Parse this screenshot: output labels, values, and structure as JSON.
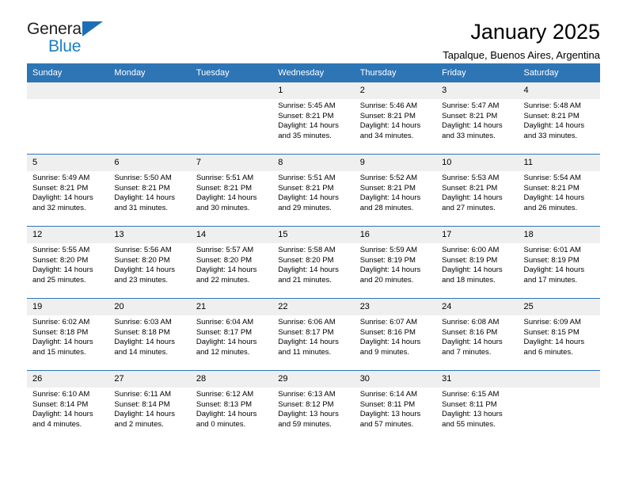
{
  "logo": {
    "top_word": "General",
    "bottom_word": "Blue",
    "triangle_color": "#1c6fb4",
    "blue_color": "#1b7fc4"
  },
  "header": {
    "title": "January 2025",
    "subtitle": "Tapalque, Buenos Aires, Argentina"
  },
  "theme": {
    "header_bg": "#2e75b6",
    "daynum_bg": "#efefef",
    "grid_line": "#2e75b6"
  },
  "calendar": {
    "weekdays": [
      "Sunday",
      "Monday",
      "Tuesday",
      "Wednesday",
      "Thursday",
      "Friday",
      "Saturday"
    ],
    "weeks": [
      [
        {
          "day": "",
          "sunrise": "",
          "sunset": "",
          "daylight_line1": "",
          "daylight_line2": ""
        },
        {
          "day": "",
          "sunrise": "",
          "sunset": "",
          "daylight_line1": "",
          "daylight_line2": ""
        },
        {
          "day": "",
          "sunrise": "",
          "sunset": "",
          "daylight_line1": "",
          "daylight_line2": ""
        },
        {
          "day": "1",
          "sunrise": "Sunrise: 5:45 AM",
          "sunset": "Sunset: 8:21 PM",
          "daylight_line1": "Daylight: 14 hours",
          "daylight_line2": "and 35 minutes."
        },
        {
          "day": "2",
          "sunrise": "Sunrise: 5:46 AM",
          "sunset": "Sunset: 8:21 PM",
          "daylight_line1": "Daylight: 14 hours",
          "daylight_line2": "and 34 minutes."
        },
        {
          "day": "3",
          "sunrise": "Sunrise: 5:47 AM",
          "sunset": "Sunset: 8:21 PM",
          "daylight_line1": "Daylight: 14 hours",
          "daylight_line2": "and 33 minutes."
        },
        {
          "day": "4",
          "sunrise": "Sunrise: 5:48 AM",
          "sunset": "Sunset: 8:21 PM",
          "daylight_line1": "Daylight: 14 hours",
          "daylight_line2": "and 33 minutes."
        }
      ],
      [
        {
          "day": "5",
          "sunrise": "Sunrise: 5:49 AM",
          "sunset": "Sunset: 8:21 PM",
          "daylight_line1": "Daylight: 14 hours",
          "daylight_line2": "and 32 minutes."
        },
        {
          "day": "6",
          "sunrise": "Sunrise: 5:50 AM",
          "sunset": "Sunset: 8:21 PM",
          "daylight_line1": "Daylight: 14 hours",
          "daylight_line2": "and 31 minutes."
        },
        {
          "day": "7",
          "sunrise": "Sunrise: 5:51 AM",
          "sunset": "Sunset: 8:21 PM",
          "daylight_line1": "Daylight: 14 hours",
          "daylight_line2": "and 30 minutes."
        },
        {
          "day": "8",
          "sunrise": "Sunrise: 5:51 AM",
          "sunset": "Sunset: 8:21 PM",
          "daylight_line1": "Daylight: 14 hours",
          "daylight_line2": "and 29 minutes."
        },
        {
          "day": "9",
          "sunrise": "Sunrise: 5:52 AM",
          "sunset": "Sunset: 8:21 PM",
          "daylight_line1": "Daylight: 14 hours",
          "daylight_line2": "and 28 minutes."
        },
        {
          "day": "10",
          "sunrise": "Sunrise: 5:53 AM",
          "sunset": "Sunset: 8:21 PM",
          "daylight_line1": "Daylight: 14 hours",
          "daylight_line2": "and 27 minutes."
        },
        {
          "day": "11",
          "sunrise": "Sunrise: 5:54 AM",
          "sunset": "Sunset: 8:21 PM",
          "daylight_line1": "Daylight: 14 hours",
          "daylight_line2": "and 26 minutes."
        }
      ],
      [
        {
          "day": "12",
          "sunrise": "Sunrise: 5:55 AM",
          "sunset": "Sunset: 8:20 PM",
          "daylight_line1": "Daylight: 14 hours",
          "daylight_line2": "and 25 minutes."
        },
        {
          "day": "13",
          "sunrise": "Sunrise: 5:56 AM",
          "sunset": "Sunset: 8:20 PM",
          "daylight_line1": "Daylight: 14 hours",
          "daylight_line2": "and 23 minutes."
        },
        {
          "day": "14",
          "sunrise": "Sunrise: 5:57 AM",
          "sunset": "Sunset: 8:20 PM",
          "daylight_line1": "Daylight: 14 hours",
          "daylight_line2": "and 22 minutes."
        },
        {
          "day": "15",
          "sunrise": "Sunrise: 5:58 AM",
          "sunset": "Sunset: 8:20 PM",
          "daylight_line1": "Daylight: 14 hours",
          "daylight_line2": "and 21 minutes."
        },
        {
          "day": "16",
          "sunrise": "Sunrise: 5:59 AM",
          "sunset": "Sunset: 8:19 PM",
          "daylight_line1": "Daylight: 14 hours",
          "daylight_line2": "and 20 minutes."
        },
        {
          "day": "17",
          "sunrise": "Sunrise: 6:00 AM",
          "sunset": "Sunset: 8:19 PM",
          "daylight_line1": "Daylight: 14 hours",
          "daylight_line2": "and 18 minutes."
        },
        {
          "day": "18",
          "sunrise": "Sunrise: 6:01 AM",
          "sunset": "Sunset: 8:19 PM",
          "daylight_line1": "Daylight: 14 hours",
          "daylight_line2": "and 17 minutes."
        }
      ],
      [
        {
          "day": "19",
          "sunrise": "Sunrise: 6:02 AM",
          "sunset": "Sunset: 8:18 PM",
          "daylight_line1": "Daylight: 14 hours",
          "daylight_line2": "and 15 minutes."
        },
        {
          "day": "20",
          "sunrise": "Sunrise: 6:03 AM",
          "sunset": "Sunset: 8:18 PM",
          "daylight_line1": "Daylight: 14 hours",
          "daylight_line2": "and 14 minutes."
        },
        {
          "day": "21",
          "sunrise": "Sunrise: 6:04 AM",
          "sunset": "Sunset: 8:17 PM",
          "daylight_line1": "Daylight: 14 hours",
          "daylight_line2": "and 12 minutes."
        },
        {
          "day": "22",
          "sunrise": "Sunrise: 6:06 AM",
          "sunset": "Sunset: 8:17 PM",
          "daylight_line1": "Daylight: 14 hours",
          "daylight_line2": "and 11 minutes."
        },
        {
          "day": "23",
          "sunrise": "Sunrise: 6:07 AM",
          "sunset": "Sunset: 8:16 PM",
          "daylight_line1": "Daylight: 14 hours",
          "daylight_line2": "and 9 minutes."
        },
        {
          "day": "24",
          "sunrise": "Sunrise: 6:08 AM",
          "sunset": "Sunset: 8:16 PM",
          "daylight_line1": "Daylight: 14 hours",
          "daylight_line2": "and 7 minutes."
        },
        {
          "day": "25",
          "sunrise": "Sunrise: 6:09 AM",
          "sunset": "Sunset: 8:15 PM",
          "daylight_line1": "Daylight: 14 hours",
          "daylight_line2": "and 6 minutes."
        }
      ],
      [
        {
          "day": "26",
          "sunrise": "Sunrise: 6:10 AM",
          "sunset": "Sunset: 8:14 PM",
          "daylight_line1": "Daylight: 14 hours",
          "daylight_line2": "and 4 minutes."
        },
        {
          "day": "27",
          "sunrise": "Sunrise: 6:11 AM",
          "sunset": "Sunset: 8:14 PM",
          "daylight_line1": "Daylight: 14 hours",
          "daylight_line2": "and 2 minutes."
        },
        {
          "day": "28",
          "sunrise": "Sunrise: 6:12 AM",
          "sunset": "Sunset: 8:13 PM",
          "daylight_line1": "Daylight: 14 hours",
          "daylight_line2": "and 0 minutes."
        },
        {
          "day": "29",
          "sunrise": "Sunrise: 6:13 AM",
          "sunset": "Sunset: 8:12 PM",
          "daylight_line1": "Daylight: 13 hours",
          "daylight_line2": "and 59 minutes."
        },
        {
          "day": "30",
          "sunrise": "Sunrise: 6:14 AM",
          "sunset": "Sunset: 8:11 PM",
          "daylight_line1": "Daylight: 13 hours",
          "daylight_line2": "and 57 minutes."
        },
        {
          "day": "31",
          "sunrise": "Sunrise: 6:15 AM",
          "sunset": "Sunset: 8:11 PM",
          "daylight_line1": "Daylight: 13 hours",
          "daylight_line2": "and 55 minutes."
        },
        {
          "day": "",
          "sunrise": "",
          "sunset": "",
          "daylight_line1": "",
          "daylight_line2": ""
        }
      ]
    ]
  }
}
